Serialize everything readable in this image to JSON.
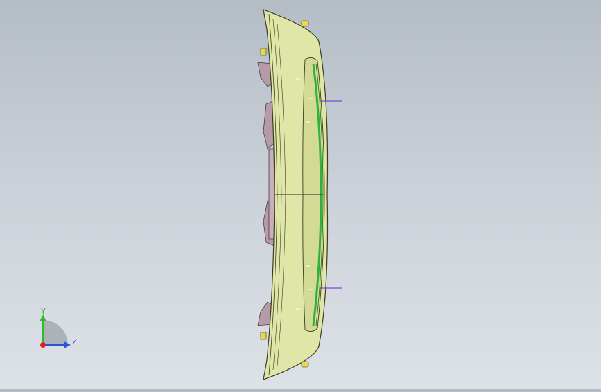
{
  "viewport": {
    "background_top": "#b4bcc5",
    "background_bottom": "#dde2e7",
    "model": {
      "body_color": "#dfe6a8",
      "edge_color": "#3a3d1e",
      "accent_color": "#2fb13a",
      "bracket_color": "#b69aa8",
      "clip_color": "#e8d84a",
      "reference_line_color": "#6a2bd0"
    }
  },
  "triad": {
    "y_label": "Y",
    "z_label": "Z",
    "y_color": "#2dbb2d",
    "z_color": "#2a55d8",
    "x_color": "#e02020"
  }
}
